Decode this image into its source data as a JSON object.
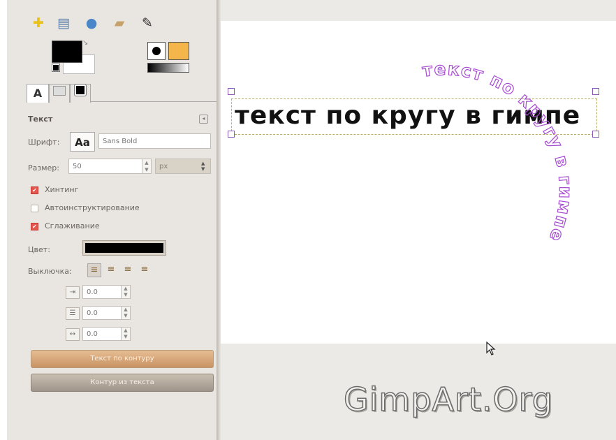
{
  "toolbox": {
    "icons": [
      "puzzle-icon",
      "document-stack-icon",
      "drop-icon",
      "folder-icon",
      "brush-icon"
    ],
    "fg_color": "#000000",
    "bg_color": "#ffffff",
    "accent_color": "#f4b64a"
  },
  "tool_options": {
    "panel_title": "Текст",
    "font_label": "Шрифт:",
    "font_preview": "Aa",
    "font_value": "Sans Bold",
    "size_label": "Размер:",
    "size_value": "50",
    "unit_value": "px",
    "hinting_label": "Хинтинг",
    "hinting_checked": true,
    "autohint_label": "Автоинструктирование",
    "autohint_checked": false,
    "antialias_label": "Сглаживание",
    "antialias_checked": true,
    "color_label": "Цвет:",
    "text_color": "#000000",
    "justify_label": "Выключка:",
    "indent_value": "0.0",
    "line_spacing_value": "0.0",
    "letter_spacing_value": "0.0",
    "path_button_label": "Текст по контуру",
    "outline_button_label": "Контур из текста"
  },
  "canvas": {
    "text_layer": "текст по кругу в гимпе",
    "curved_text": "текст по кругу в гимпе",
    "curve_color": "#a64bd1"
  },
  "watermark": "GimpArt.Org"
}
